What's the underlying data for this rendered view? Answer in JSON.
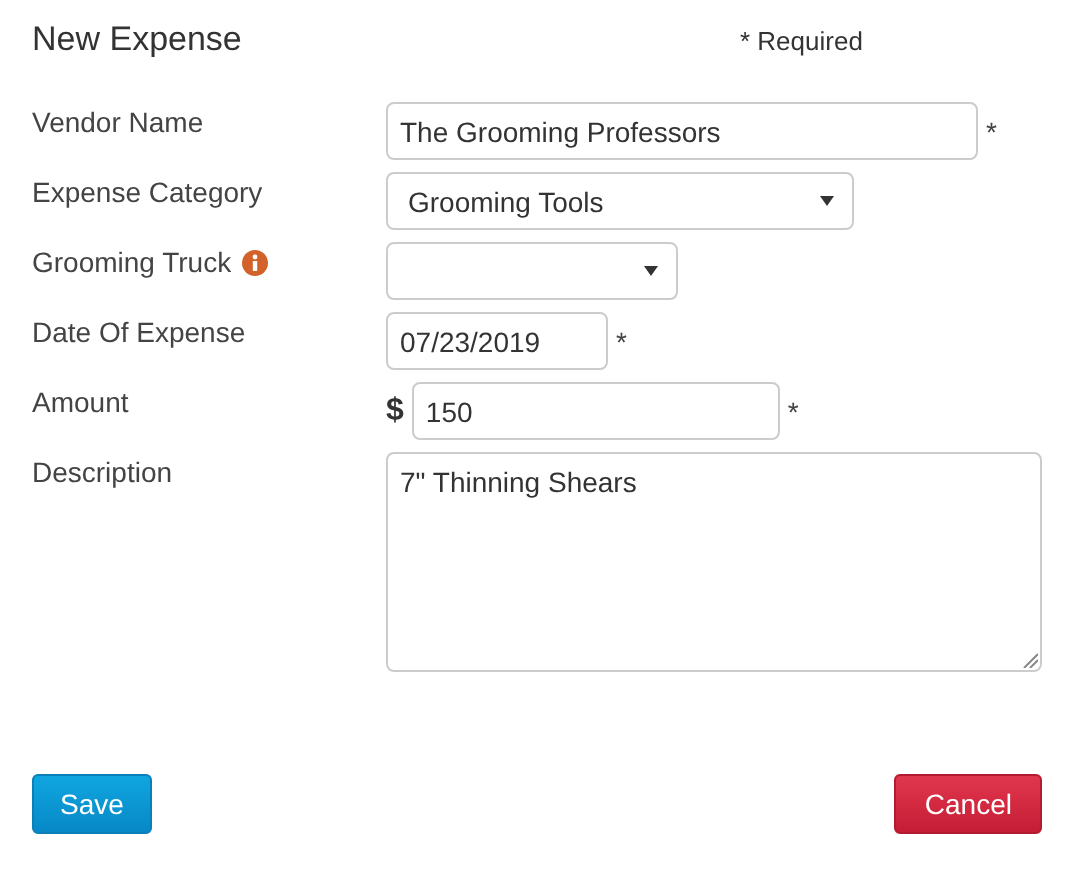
{
  "title": "New Expense",
  "required_note": "* Required",
  "fields": [
    {
      "kind": "text",
      "label": "Vendor Name",
      "value": "The Grooming Professors",
      "info": false,
      "required_mark": "*"
    },
    {
      "kind": "select",
      "label": "Expense Category",
      "value": "Grooming Tools",
      "info": false
    },
    {
      "kind": "select",
      "label": "Grooming Truck",
      "info": true
    },
    {
      "kind": "text",
      "label": "Date Of Expense",
      "value": "07/23/2019",
      "info": false,
      "required_mark": "*"
    },
    {
      "kind": "currency",
      "label": "Amount",
      "prefix": "$",
      "value": "150",
      "info": false,
      "required_mark": "*"
    },
    {
      "kind": "textarea",
      "label": "Description",
      "value": "7\" Thinning Shears",
      "info": false
    }
  ],
  "buttons": [
    {
      "kind": "primary",
      "label": "Save"
    },
    {
      "kind": "danger",
      "label": "Cancel"
    }
  ]
}
